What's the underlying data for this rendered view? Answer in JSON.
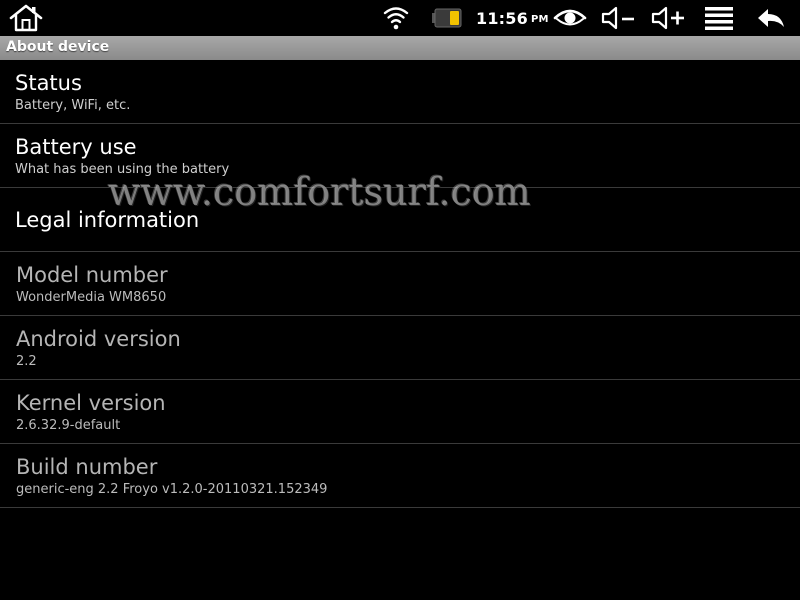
{
  "status_bar": {
    "time": "11:56",
    "ampm": "PM",
    "icons": [
      "home-icon",
      "wifi-icon",
      "battery-icon",
      "eye-icon",
      "volume-down-icon",
      "volume-up-icon",
      "menu-icon",
      "back-icon"
    ],
    "accent_battery": "#f2c200"
  },
  "title_bar": {
    "title": "About device"
  },
  "items": [
    {
      "title": "Status",
      "summary": "Battery, WiFi, etc."
    },
    {
      "title": "Battery use",
      "summary": "What has been using the battery"
    },
    {
      "title": "Legal information",
      "summary": ""
    },
    {
      "title": "Model number",
      "summary": "WonderMedia WM8650"
    },
    {
      "title": "Android version",
      "summary": "2.2"
    },
    {
      "title": "Kernel version",
      "summary": "2.6.32.9-default"
    },
    {
      "title": "Build number",
      "summary": "generic-eng 2.2 Froyo v1.2.0-20110321.152349"
    }
  ],
  "watermark": "www.comfortsurf.com"
}
